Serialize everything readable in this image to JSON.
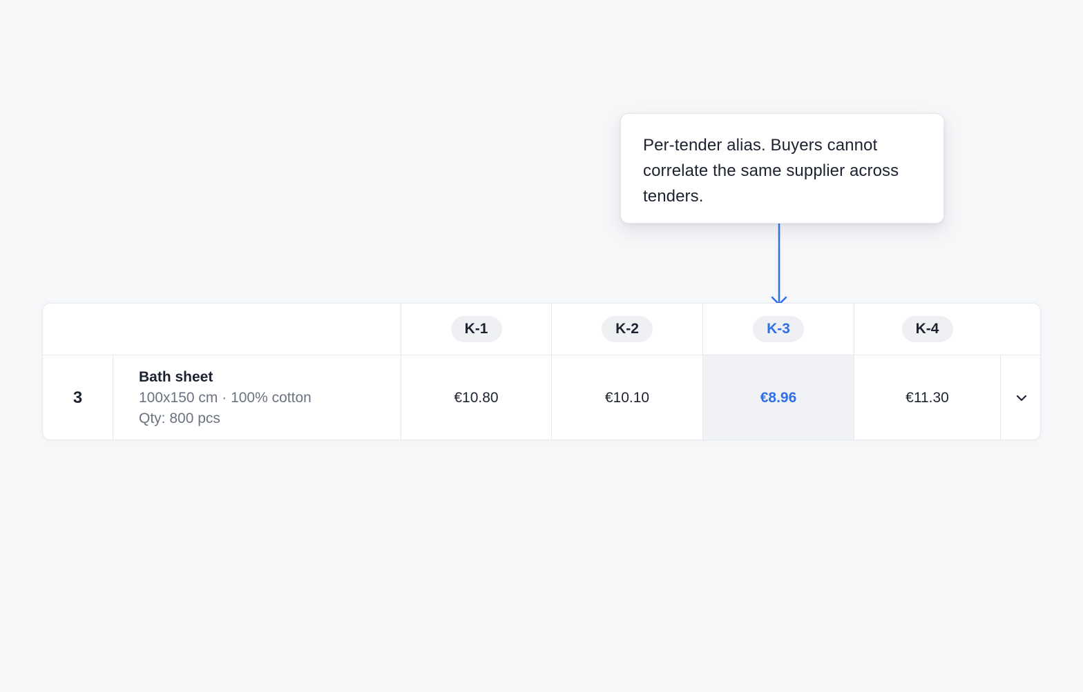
{
  "tooltip": {
    "text": "Per-tender alias. Buyers cannot correlate the same supplier across tenders."
  },
  "table": {
    "suppliers": [
      {
        "alias": "K-1",
        "highlighted": false
      },
      {
        "alias": "K-2",
        "highlighted": false
      },
      {
        "alias": "K-3",
        "highlighted": true
      },
      {
        "alias": "K-4",
        "highlighted": false
      }
    ],
    "row": {
      "index": "3",
      "item_name": "Bath sheet",
      "item_spec": "100x150 cm · 100% cotton",
      "item_qty": "Qty: 800 pcs",
      "prices": [
        "€10.80",
        "€10.10",
        "€8.96",
        "€11.30"
      ]
    }
  },
  "colors": {
    "accent": "#2f6fe8",
    "text": "#1c2230",
    "muted": "#6b7280",
    "highlight_bg": "#f0f2f6"
  },
  "icons": {
    "expand": "chevron-down-icon",
    "connector": "arrow-down-icon"
  }
}
